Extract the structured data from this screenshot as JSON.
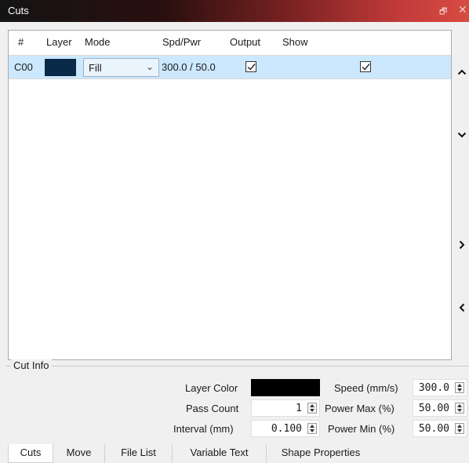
{
  "window": {
    "title": "Cuts",
    "float_glyph": "🗗",
    "close_glyph": "✕"
  },
  "table": {
    "columns": [
      "#",
      "Layer",
      "Mode",
      "Spd/Pwr",
      "Output",
      "Show"
    ],
    "rows": [
      {
        "id": "C00",
        "layer_color": "#0a2a4a",
        "mode": "Fill",
        "spd_pwr": "300.0 / 50.0",
        "output": true,
        "show": true
      }
    ]
  },
  "side_buttons": [
    "chevron-up",
    "chevron-down",
    "chevron-right",
    "chevron-left"
  ],
  "cut_info": {
    "legend": "Cut Info",
    "layer_color_label": "Layer Color",
    "layer_color": "#000000",
    "pass_count_label": "Pass Count",
    "pass_count": "1",
    "interval_label": "Interval (mm)",
    "interval": "0.100",
    "speed_label": "Speed (mm/s)",
    "speed": "300.0",
    "power_max_label": "Power Max (%)",
    "power_max": "50.00",
    "power_min_label": "Power Min (%)",
    "power_min": "50.00"
  },
  "tabs": [
    "Cuts",
    "Move",
    "File List",
    "Variable Text",
    "Shape Properties"
  ],
  "active_tab": "Cuts"
}
